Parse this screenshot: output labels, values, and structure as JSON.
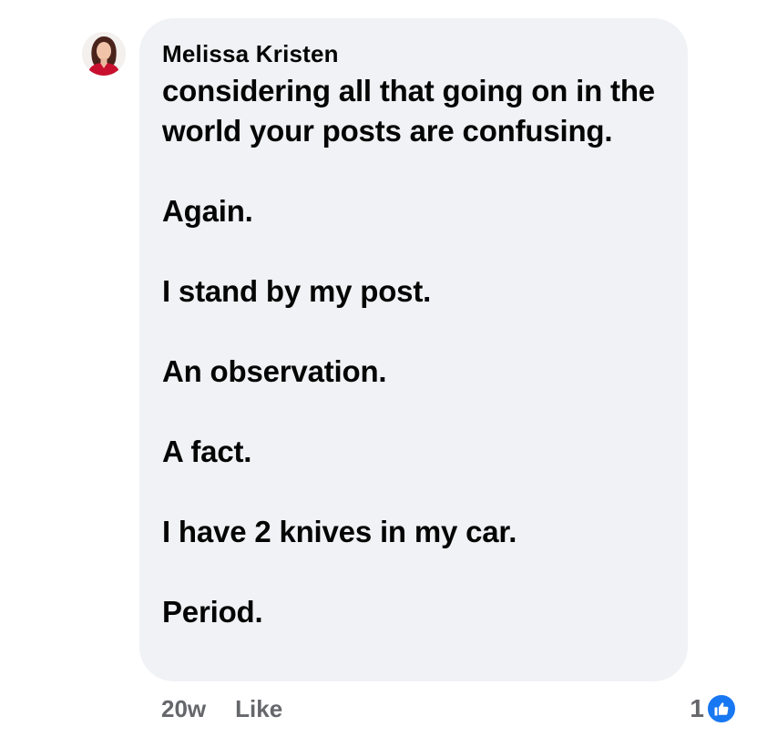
{
  "comment": {
    "author": "Melissa Kristen",
    "paragraphs": [
      "considering all that going on in the world your posts are confusing.",
      "Again.",
      "I stand by my post.",
      "An observation.",
      "A fact.",
      "I have 2 knives in my car.",
      "Period."
    ],
    "timestamp": "20w",
    "like_label": "Like",
    "reaction_count": "1",
    "reaction_icon": "like-thumb-icon",
    "colors": {
      "bubble": "#f0f2f5",
      "meta_text": "#65676b",
      "like_blue": "#1877f2"
    }
  }
}
